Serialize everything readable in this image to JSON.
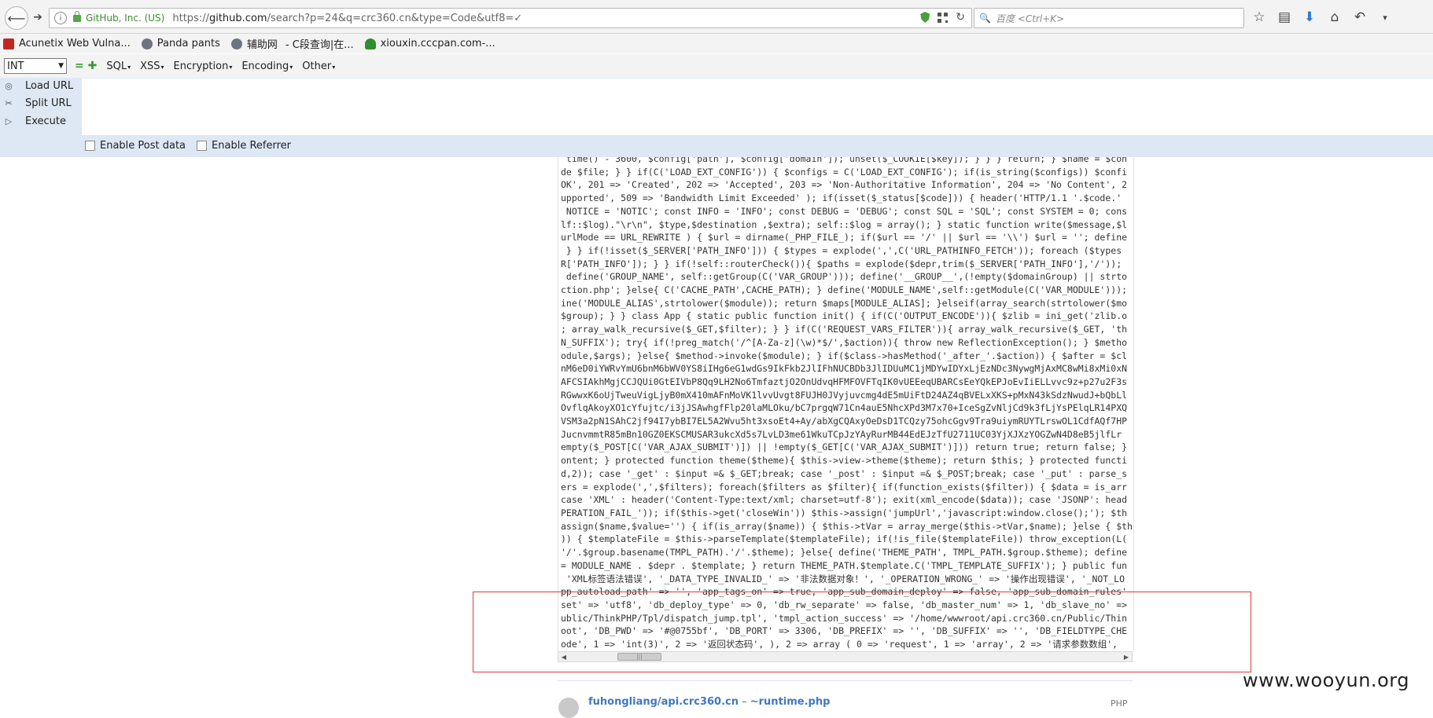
{
  "navbar": {
    "identity": "GitHub, Inc. (US)",
    "url_prefix": "https://",
    "url_host": "github.com",
    "url_path": "/search?p=24&q=crc360.cn&type=Code&utf8=✓",
    "search_placeholder": "百度 <Ctrl+K>",
    "icons": [
      "back-icon",
      "forward-icon",
      "info-icon",
      "lock-icon",
      "shield-icon",
      "qr-code-icon",
      "reload-icon",
      "search-icon",
      "bookmark-star-icon",
      "reading-list-icon",
      "download-icon",
      "home-icon",
      "undo-icon",
      "menu-dropdown-icon"
    ]
  },
  "bookmarks": [
    {
      "label": "Acunetix Web Vulna...",
      "icon": "acunetix-icon"
    },
    {
      "label": "Panda pants",
      "icon": "globe-icon"
    },
    {
      "label": "辅助网",
      "icon": "globe-icon"
    },
    {
      "label": "- C段查询|在...",
      "icon": ""
    },
    {
      "label": "xiouxin.cccpan.com-...",
      "icon": "tree-icon"
    }
  ],
  "hackbar": {
    "select_value": "INT",
    "menus": [
      "SQL",
      "XSS",
      "Encryption",
      "Encoding",
      "Other"
    ],
    "load_url": "Load URL",
    "split_url": "Split URL",
    "execute": "Execute",
    "enable_post": "Enable Post data",
    "enable_referrer": "Enable Referrer"
  },
  "code": {
    "lines": [
      " time() - 3600, $config['path'], $config['domain']); unset($_COOKIE[$key]); } } } return; } $name = $con",
      "de $file; } } if(C('LOAD_EXT_CONFIG')) { $configs = C('LOAD_EXT_CONFIG'); if(is_string($configs)) $confi",
      "OK', 201 => 'Created', 202 => 'Accepted', 203 => 'Non-Authoritative Information', 204 => 'No Content', 2",
      "upported', 509 => 'Bandwidth Limit Exceeded' ); if(isset($_status[$code])) { header('HTTP/1.1 '.$code.'",
      " NOTICE = 'NOTIC'; const INFO = 'INFO'; const DEBUG = 'DEBUG'; const SQL = 'SQL'; const SYSTEM = 0; cons",
      "lf::$log).\"\\r\\n\", $type,$destination ,$extra); self::$log = array(); } static function write($message,$l",
      "urlMode == URL_REWRITE ) { $url = dirname(_PHP_FILE_); if($url == '/' || $url == '\\\\') $url = ''; define",
      " } } if(!isset($_SERVER['PATH_INFO'])) { $types = explode(',',C('URL_PATHINFO_FETCH')); foreach ($types",
      "R['PATH_INFO']); } } if(!self::routerCheck()){ $paths = explode($depr,trim($_SERVER['PATH_INFO'],'/'));",
      " define('GROUP_NAME', self::getGroup(C('VAR_GROUP'))); define('__GROUP__',(!empty($domainGroup) || strto",
      "ction.php'; }else{ C('CACHE_PATH',CACHE_PATH); } define('MODULE_NAME',self::getModule(C('VAR_MODULE')));",
      "ine('MODULE_ALIAS',strtolower($module)); return $maps[MODULE_ALIAS]; }elseif(array_search(strtolower($mo",
      "$group); } } class App { static public function init() { if(C('OUTPUT_ENCODE')){ $zlib = ini_get('zlib.o",
      "; array_walk_recursive($_GET,$filter); } } if(C('REQUEST_VARS_FILTER')){ array_walk_recursive($_GET, 'th",
      "N_SUFFIX'); try{ if(!preg_match('/^[A-Za-z](\\w)*$/',$action)){ throw new ReflectionException(); } $metho",
      "odule,$args); }else{ $method->invoke($module); } if($class->hasMethod('_after_'.$action)) { $after = $cl",
      "nM6eD0iYWRvYmU6bnM6bWV0YS8iIHg6eG1wdGs9IkFkb2JlIFhNUCBDb3JlIDUuMC1jMDYwIDYxLjEzNDc3NywgMjAxMC8wMi8xMi0xN",
      "AFCSIAkhMgjCCJQUi0GtEIVbP8Qq9LH2No6TmfaztjO2OnUdvqHFMFOVFTqIK0vUEEeqUBARCsEeYQkEPJoEvIiELLvvc9z+p27u2F3s",
      "RGwwxK6oUjTweuVigLjyB0mX410mAFnMoVK1lvvUvgt8FUJH0JVyjuvcmg4dE5mUiFtD24AZ4qBVELxXKS+pMxN43kSdzNwudJ+bQbLl",
      "OvflqAkoyXO1cYfujtc/i3jJSAwhgfFlp20laMLOku/bC7prgqW71Cn4auE5NhcXPd3M7x70+IceSgZvNljCd9k3fLjYsPElqLR14PXQ",
      "VSM3a2pN1SAhC2jf94I7ybBI7EL5A2Wvu5ht3xsoEt4+Ay/abXgCQAxyOeDsD1TCQzy75ohcGgv9Tra9uiymRUYTLrswOL1CdfAQf7HP",
      "JucnvmmtR85mBn10GZ0EKSCMUSAR3ukcXd5s7LvLD3me61WkuTCpJzYAyRurMB44EdEJzTfU2711UC03YjXJXzYOGZwN4D8eB5jlfLr",
      "empty($_POST[C('VAR_AJAX_SUBMIT')]) || !empty($_GET[C('VAR_AJAX_SUBMIT')])) return true; return false; }",
      "ontent; } protected function theme($theme){ $this->view->theme($theme); return $this; } protected functi",
      "d,2)); case '_get' : $input =& $_GET;break; case '_post' : $input =& $_POST;break; case '_put' : parse_s",
      "ers = explode(',',$filters); foreach($filters as $filter){ if(function_exists($filter)) { $data = is_arr",
      "case 'XML' : header('Content-Type:text/xml; charset=utf-8'); exit(xml_encode($data)); case 'JSONP': head",
      "PERATION_FAIL_')); if($this->get('closeWin')) $this->assign('jumpUrl','javascript:window.close();'); $th",
      "assign($name,$value='') { if(is_array($name)) { $this->tVar = array_merge($this->tVar,$name); }else { $th",
      ")) { $templateFile = $this->parseTemplate($templateFile); if(!is_file($templateFile)) throw_exception(L(",
      "'/'.$group.basename(TMPL_PATH).'/'.$theme); }else{ define('THEME_PATH', TMPL_PATH.$group.$theme); define",
      "= MODULE_NAME . $depr . $template; } return THEME_PATH.$template.C('TMPL_TEMPLATE_SUFFIX'); } public fun",
      " 'XML标签语法错误', '_DATA_TYPE_INVALID_' => '非法数据对象！', '_OPERATION_WRONG_' => '操作出现错误', '_NOT_LO",
      "pp_autoload_path' => '', 'app_tags_on' => true, 'app_sub_domain_deploy' => false, 'app_sub_domain_rules'",
      "set' => 'utf8', 'db_deploy_type' => 0, 'db_rw_separate' => false, 'db_master_num' => 1, 'db_slave_no' =>",
      "ublic/ThinkPHP/Tpl/dispatch_jump.tpl', 'tmpl_action_success' => '/home/wwwroot/api.crc360.cn/Public/Thin",
      "oot', 'DB_PWD' => '#@0755bf', 'DB_PORT' => 3306, 'DB_PREFIX' => '', 'DB_SUFFIX' => '', 'DB_FIELDTYPE_CHE",
      "ode', 1 => 'int(3)', 2 => '返回状态码', ), 2 => array ( 0 => 'request', 1 => 'array', 2 => '请求参数数组',"
    ]
  },
  "result": {
    "repo": "fuhongliang/api.crc360.cn",
    "separator": " – ",
    "file": "~runtime.php",
    "language": "PHP"
  },
  "watermark": "www.wooyun.org"
}
